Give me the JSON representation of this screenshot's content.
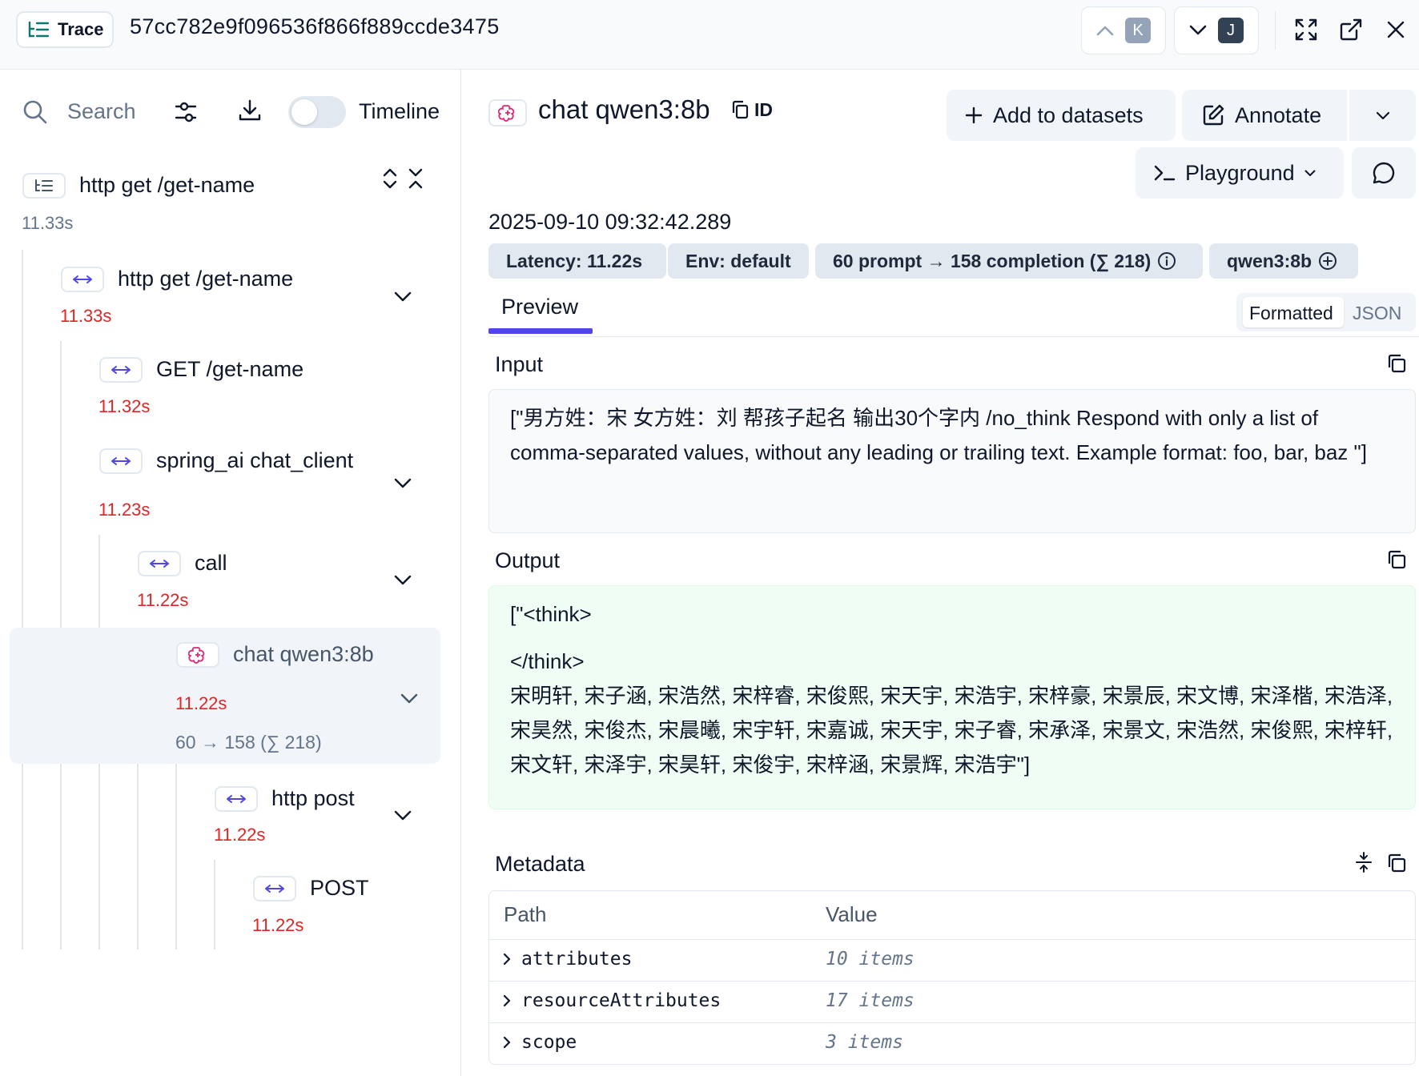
{
  "header": {
    "trace_label": "Trace",
    "trace_id": "57cc782e9f096536f866f889ccde3475",
    "prev_key": "K",
    "next_key": "J"
  },
  "sidebar": {
    "search_label": "Search",
    "timeline_label": "Timeline",
    "timeline_enabled": false,
    "tree": [
      {
        "name": "http get /get-name",
        "time": "11.33s",
        "icon": "trace-icon"
      },
      {
        "name": "http get /get-name",
        "time": "11.33s",
        "icon": "span-icon"
      },
      {
        "name": "GET /get-name",
        "time": "11.32s",
        "icon": "span-icon"
      },
      {
        "name": "spring_ai chat_client",
        "time": "11.23s",
        "icon": "span-icon"
      },
      {
        "name": "call",
        "time": "11.22s",
        "icon": "span-icon"
      },
      {
        "name": "chat qwen3:8b",
        "time": "11.22s",
        "tokens": "60 → 158 (∑ 218)",
        "icon": "generation-icon",
        "selected": true
      },
      {
        "name": "http post",
        "time": "11.22s",
        "icon": "span-icon"
      },
      {
        "name": "POST",
        "time": "11.22s",
        "icon": "span-icon"
      }
    ]
  },
  "detail": {
    "title": "chat qwen3:8b",
    "id_label": "ID",
    "add_to_datasets": "Add to datasets",
    "annotate": "Annotate",
    "playground": "Playground",
    "timestamp": "2025-09-10 09:32:42.289",
    "pills": {
      "latency": "Latency: 11.22s",
      "env": "Env: default",
      "tokens": "60 prompt → 158 completion (∑ 218)",
      "model": "qwen3:8b"
    },
    "tabs": {
      "preview": "Preview"
    },
    "view_mode": {
      "formatted": "Formatted",
      "json": "JSON",
      "selected": "Formatted"
    },
    "input": {
      "title": "Input",
      "text": "[\"男方姓：宋 女方姓：刘 帮孩子起名 输出30个字内 /no_think Respond with only a list of comma-separated values, without any leading or trailing text. Example format: foo, bar, baz \"]"
    },
    "output": {
      "title": "Output",
      "line1": "[\"<think>",
      "line2": "</think>",
      "names": "宋明轩, 宋子涵, 宋浩然, 宋梓睿, 宋俊熙, 宋天宇, 宋浩宇, 宋梓豪, 宋景辰, 宋文博, 宋泽楷, 宋浩泽, 宋昊然, 宋俊杰, 宋晨曦, 宋宇轩, 宋嘉诚, 宋天宇, 宋子睿, 宋承泽, 宋景文, 宋浩然, 宋俊熙, 宋梓轩, 宋文轩, 宋泽宇, 宋昊轩, 宋俊宇, 宋梓涵, 宋景辉, 宋浩宇\"]"
    },
    "metadata": {
      "title": "Metadata",
      "col_path": "Path",
      "col_value": "Value",
      "rows": [
        {
          "path": "attributes",
          "value": "10 items"
        },
        {
          "path": "resourceAttributes",
          "value": "17 items"
        },
        {
          "path": "scope",
          "value": "3 items"
        }
      ]
    }
  },
  "colors": {
    "accent": "#4f46e5",
    "duration": "#dc2626",
    "output_bg": "#f0fdf4",
    "kbd": "#475569"
  }
}
